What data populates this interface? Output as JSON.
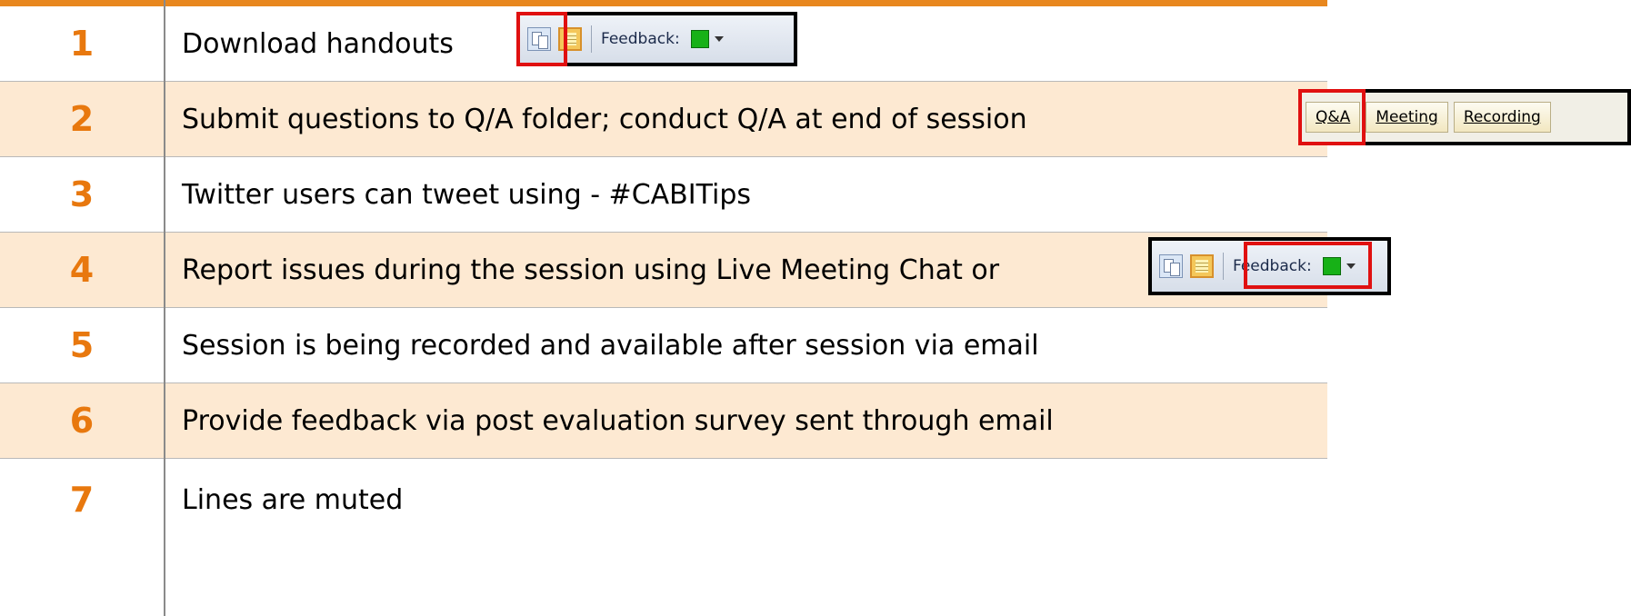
{
  "rows": [
    {
      "number": "1",
      "text": "Download handouts"
    },
    {
      "number": "2",
      "text": "Submit questions to Q/A folder; conduct Q/A at end of session"
    },
    {
      "number": "3",
      "text": "Twitter users can tweet using - #CABITips"
    },
    {
      "number": "4",
      "text": "Report issues during the session using Live Meeting Chat or"
    },
    {
      "number": "5",
      "text": "Session is being recorded and available after session via email"
    },
    {
      "number": "6",
      "text": "Provide feedback via post evaluation survey sent through email"
    },
    {
      "number": "7",
      "text": "Lines are muted"
    }
  ],
  "toolbar": {
    "feedback_label": "Feedback:",
    "icons": [
      "handouts-icon",
      "notes-icon",
      "feedback-status-icon"
    ],
    "status_color": "#17b117"
  },
  "tabs": [
    "Q&A",
    "Meeting",
    "Recording"
  ],
  "colors": {
    "accent": "#e8871e",
    "number": "#e8780e",
    "even_row": "#fde9d2",
    "highlight": "#e01010"
  }
}
